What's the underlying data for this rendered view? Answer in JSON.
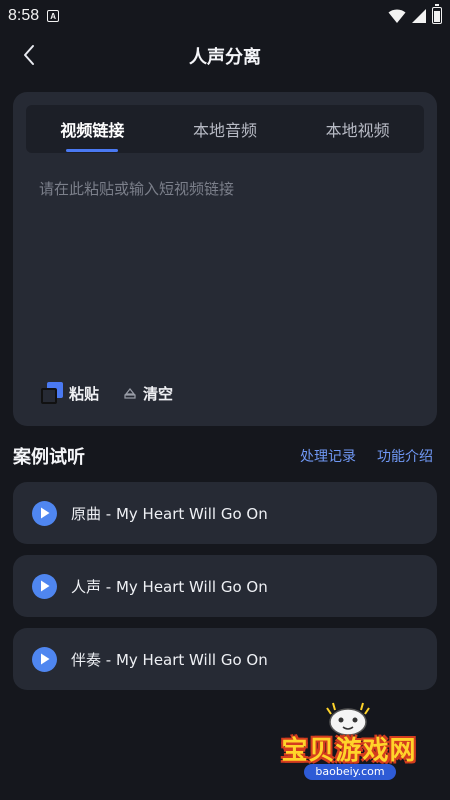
{
  "status_bar": {
    "time": "8:58",
    "notification_glyph": "A",
    "icons": [
      "wifi-icon",
      "signal-icon",
      "battery-icon"
    ]
  },
  "header": {
    "title": "人声分离",
    "back_icon": "chevron-left-icon"
  },
  "input_card": {
    "tabs": [
      {
        "label": "视频链接",
        "active": true
      },
      {
        "label": "本地音频",
        "active": false
      },
      {
        "label": "本地视频",
        "active": false
      }
    ],
    "link_input": {
      "value": "",
      "placeholder": "请在此粘贴或输入短视频链接"
    },
    "actions": {
      "paste_label": "粘贴",
      "clear_label": "清空"
    }
  },
  "examples": {
    "title": "案例试听",
    "history_link": "处理记录",
    "intro_link": "功能介绍",
    "items": [
      {
        "label": "原曲 - My Heart Will Go On"
      },
      {
        "label": "人声 - My Heart Will Go On"
      },
      {
        "label": "伴奏 - My Heart Will Go On"
      }
    ]
  },
  "watermark": {
    "title": "宝贝游戏网",
    "url": "baobeiy.com"
  },
  "colors": {
    "background": "#15171d",
    "card": "#262a34",
    "accent": "#4a79f2",
    "link": "#6f97f3"
  }
}
